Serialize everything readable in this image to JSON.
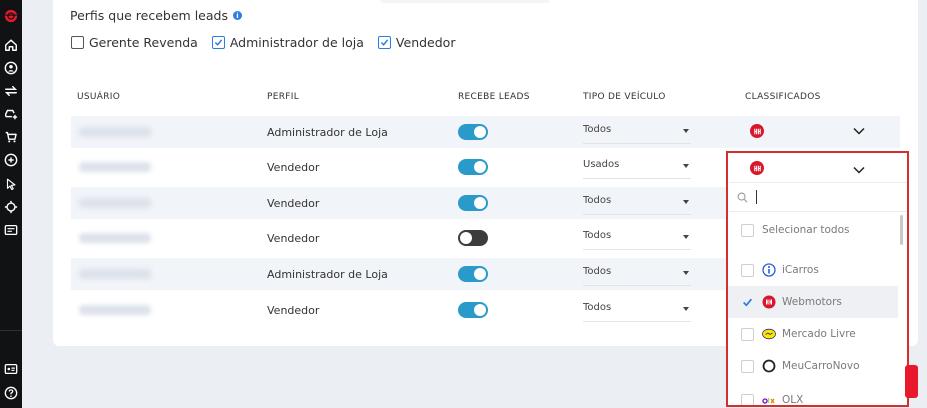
{
  "section": {
    "title": "Perfis que recebem leads"
  },
  "profiles": [
    {
      "label": "Gerente Revenda",
      "checked": false
    },
    {
      "label": "Administrador de loja",
      "checked": true
    },
    {
      "label": "Vendedor",
      "checked": true
    }
  ],
  "table": {
    "headers": [
      "USUÁRIO",
      "PERFIL",
      "RECEBE LEADS",
      "TIPO DE VEÍCULO",
      "CLASSIFICADOS"
    ],
    "rows": [
      {
        "perfil": "Administrador de Loja",
        "recebe_leads": true,
        "tipo": "Todos"
      },
      {
        "perfil": "Vendedor",
        "recebe_leads": true,
        "tipo": "Usados"
      },
      {
        "perfil": "Vendedor",
        "recebe_leads": true,
        "tipo": "Todos"
      },
      {
        "perfil": "Vendedor",
        "recebe_leads": false,
        "tipo": "Todos"
      },
      {
        "perfil": "Administrador de Loja",
        "recebe_leads": true,
        "tipo": "Todos"
      },
      {
        "perfil": "Vendedor",
        "recebe_leads": true,
        "tipo": "Todos"
      }
    ]
  },
  "dropdown": {
    "search_placeholder": "",
    "select_all": "Selecionar todos",
    "options": [
      {
        "label": "iCarros",
        "checked": false,
        "icon": "icarros-logo"
      },
      {
        "label": "Webmotors",
        "checked": true,
        "icon": "webmotors-logo"
      },
      {
        "label": "Mercado Livre",
        "checked": false,
        "icon": "mercado-livre-logo"
      },
      {
        "label": "MeuCarroNovo",
        "checked": false,
        "icon": "meucarronovo-logo"
      },
      {
        "label": "OLX",
        "checked": false,
        "icon": "olx-logo"
      }
    ]
  },
  "colors": {
    "accent": "#2a7de1",
    "toggle_on": "#2a9acb",
    "toggle_off": "#3c3c3c",
    "brand_red": "#d8162c",
    "highlight_border": "#d32f2f",
    "sidebar": "#111214"
  }
}
